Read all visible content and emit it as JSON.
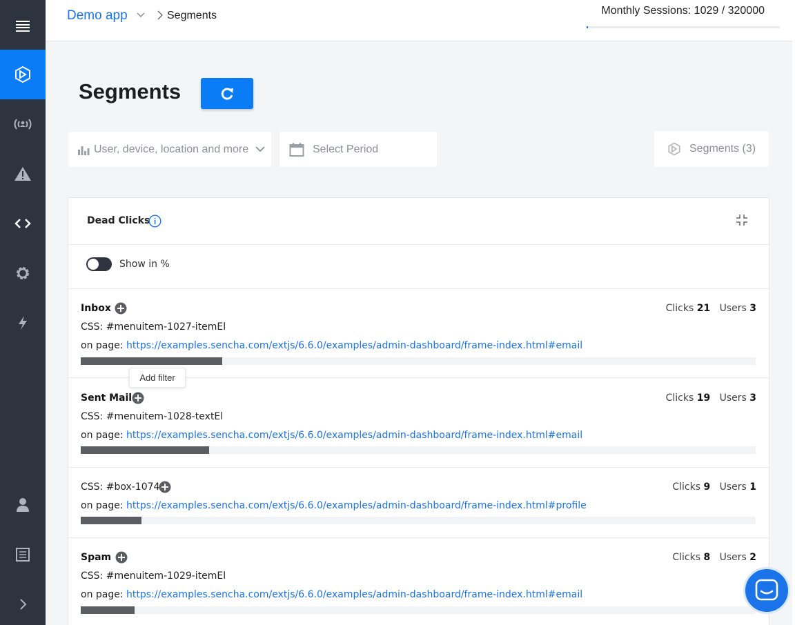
{
  "sidebar": {
    "items": [
      {
        "name": "menu",
        "icon": "menu-icon"
      },
      {
        "name": "segments",
        "icon": "segments-logo-icon",
        "active": true
      },
      {
        "name": "live",
        "icon": "broadcast-user-icon"
      },
      {
        "name": "alerts",
        "icon": "warning-icon"
      },
      {
        "name": "code",
        "icon": "code-icon"
      },
      {
        "name": "settings",
        "icon": "gear-icon"
      },
      {
        "name": "integrations",
        "icon": "lightning-icon"
      },
      {
        "name": "account",
        "icon": "user-icon"
      },
      {
        "name": "docs",
        "icon": "document-icon"
      },
      {
        "name": "expand",
        "icon": "chevron-right-icon"
      }
    ]
  },
  "header": {
    "app_name": "Demo app",
    "breadcrumb_current": "Segments",
    "sessions_text": "Monthly Sessions: 1029 / 320000",
    "sessions_fraction": 0.003
  },
  "page": {
    "title": "Segments"
  },
  "filters": {
    "user_placeholder": "User, device, location and more",
    "period_placeholder": "Select Period",
    "segments_label": "Segments (3)"
  },
  "card": {
    "title": "Dead Clicks",
    "toggle_label": "Show in %",
    "tooltip": "Add filter",
    "clicks_label": "Clicks",
    "users_label": "Users",
    "page_prefix": "on page:",
    "rows": [
      {
        "name": "Inbox",
        "css": "CSS: #menuitem-1027-itemEl",
        "url": "https://examples.sencha.com/extjs/6.6.0/examples/admin-dashboard/frame-index.html#email",
        "clicks": "21",
        "users": "3",
        "fraction": 0.21
      },
      {
        "name": "Sent Mail",
        "css": "CSS: #menuitem-1028-textEl",
        "url": "https://examples.sencha.com/extjs/6.6.0/examples/admin-dashboard/frame-index.html#email",
        "clicks": "19",
        "users": "3",
        "fraction": 0.19
      },
      {
        "name": "",
        "css": "CSS: #box-1074",
        "url": "https://examples.sencha.com/extjs/6.6.0/examples/admin-dashboard/frame-index.html#profile",
        "clicks": "9",
        "users": "1",
        "fraction": 0.09
      },
      {
        "name": "Spam",
        "css": "CSS: #menuitem-1029-itemEl",
        "url": "https://examples.sencha.com/extjs/6.6.0/examples/admin-dashboard/frame-index.html#email",
        "clicks": "8",
        "users": "2",
        "fraction": 0.08
      }
    ]
  },
  "colors": {
    "accent": "#0a7cf6",
    "sidebar": "#2e3340",
    "bar": "#5b5d63",
    "link": "#1a73e8"
  }
}
